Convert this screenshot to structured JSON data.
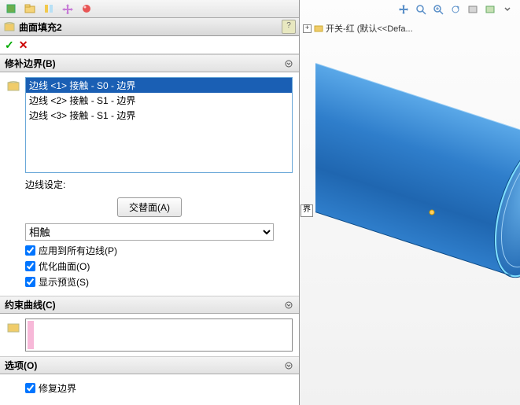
{
  "tabs": {
    "help": "?"
  },
  "title": "曲面填充2",
  "sections": {
    "patch": "修补边界(B)",
    "constraint": "约束曲线(C)",
    "options": "选项(O)"
  },
  "edges": {
    "items": [
      "边线 <1> 接触 - S0 - 边界",
      "边线 <2> 接触 - S1 - 边界",
      "边线 <3> 接触 - S1 - 边界"
    ],
    "selected": 0,
    "settingLabel": "边线设定:"
  },
  "buttons": {
    "altFace": "交替面(A)"
  },
  "contactSelect": "相触",
  "checks": {
    "applyAll": "应用到所有边线(P)",
    "optFace": "优化曲面(O)",
    "preview": "显示预览(S)",
    "repair": "修复边界"
  },
  "tree": {
    "root": "开关-红  (默认<<Defa..."
  },
  "marker": "界"
}
